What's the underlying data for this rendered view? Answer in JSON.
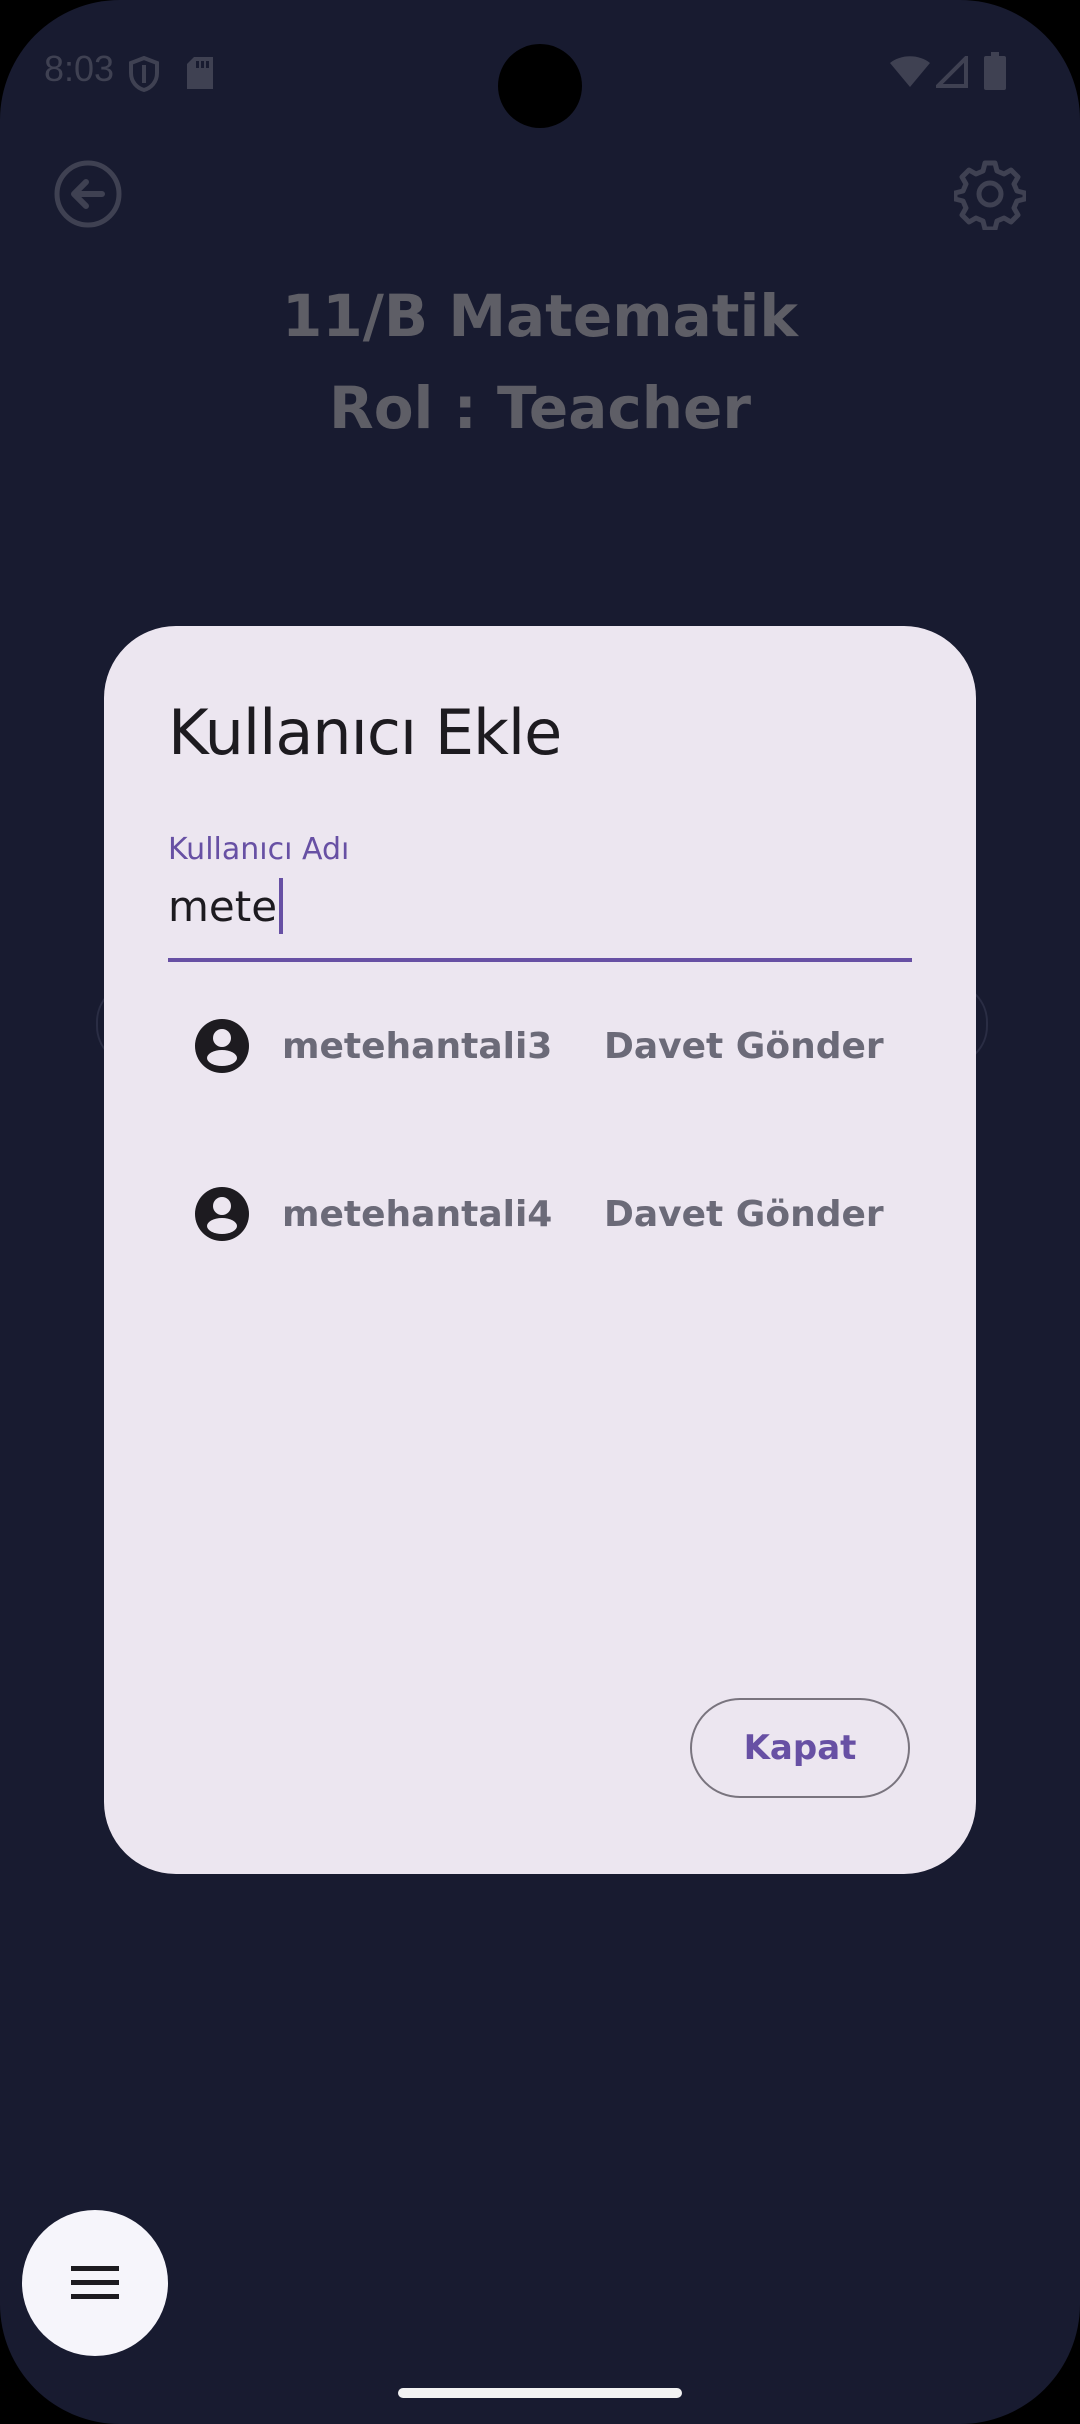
{
  "status_bar": {
    "time": "8:03",
    "icons": [
      "shield-icon",
      "sd-card-icon",
      "wifi-icon",
      "cellular-signal-icon",
      "battery-icon"
    ]
  },
  "header": {
    "back_icon": "arrow-left-circle-icon",
    "settings_icon": "gear-icon",
    "title_line1": "11/B Matematik",
    "title_line2": "Rol : Teacher"
  },
  "dialog": {
    "title": "Kullanıcı Ekle",
    "field_label": "Kullanıcı Adı",
    "field_value": "mete",
    "results": [
      {
        "username": "metehantali3",
        "action": "Davet Gönder"
      },
      {
        "username": "metehantali4",
        "action": "Davet Gönder"
      }
    ],
    "close_label": "Kapat"
  },
  "fab": {
    "icon": "menu-icon"
  },
  "colors": {
    "background": "#181b30",
    "dialog": "#ece6f0",
    "accent": "#6750a4",
    "muted_text": "#6b6a78"
  }
}
